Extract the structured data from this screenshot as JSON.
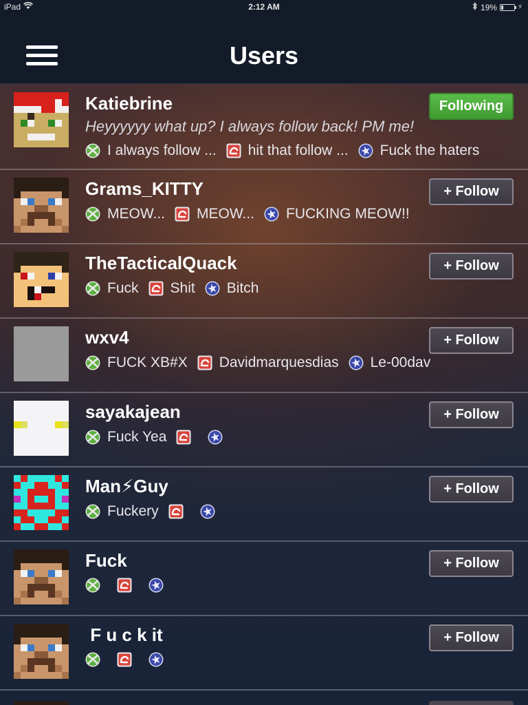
{
  "status_bar": {
    "device": "iPad",
    "time": "2:12 AM",
    "battery": "19%",
    "battery_level": 0.19
  },
  "nav": {
    "title": "Users",
    "menu_icon": "hamburger-icon"
  },
  "colors": {
    "following_green": "#4caf3a",
    "follow_button": "#46424c",
    "xbox_green": "#5cb040",
    "ps_blue": "#3f4fbf",
    "kik_red": "#e0443a"
  },
  "users": [
    {
      "username": "Katiebrine",
      "bio": "Heyyyyyy what up? I always follow back! PM me!",
      "xbox": "I always follow ...",
      "kik": "hit that follow ...",
      "psn": "Fuck the haters",
      "button": "Following",
      "following": true
    },
    {
      "username": "Grams_KITTY",
      "bio": "",
      "xbox": "MEOW...",
      "kik": "MEOW...",
      "psn": "FUCKING MEOW!!",
      "button": "+ Follow",
      "following": false
    },
    {
      "username": "TheTacticalQuack",
      "bio": "",
      "xbox": "Fuck",
      "kik": "Shit",
      "psn": "Bitch",
      "button": "+ Follow",
      "following": false
    },
    {
      "username": "wxv4",
      "bio": "",
      "xbox": "FUCK XB#X",
      "kik": "Davidmarquesdias",
      "psn": "Le-00dav",
      "button": "+ Follow",
      "following": false
    },
    {
      "username": "sayakajean",
      "bio": "",
      "xbox": "Fuck Yea",
      "kik": "",
      "psn": "",
      "button": "+ Follow",
      "following": false
    },
    {
      "username": "Man⚡Guy",
      "bio": "",
      "xbox": "Fuckery",
      "kik": "",
      "psn": "",
      "button": "+ Follow",
      "following": false
    },
    {
      "username": "Fuck",
      "bio": "",
      "xbox": "",
      "kik": "",
      "psn": "",
      "button": "+ Follow",
      "following": false
    },
    {
      "username": " F u c k it",
      "bio": "",
      "xbox": "",
      "kik": "",
      "psn": "",
      "button": "+ Follow",
      "following": false
    }
  ]
}
